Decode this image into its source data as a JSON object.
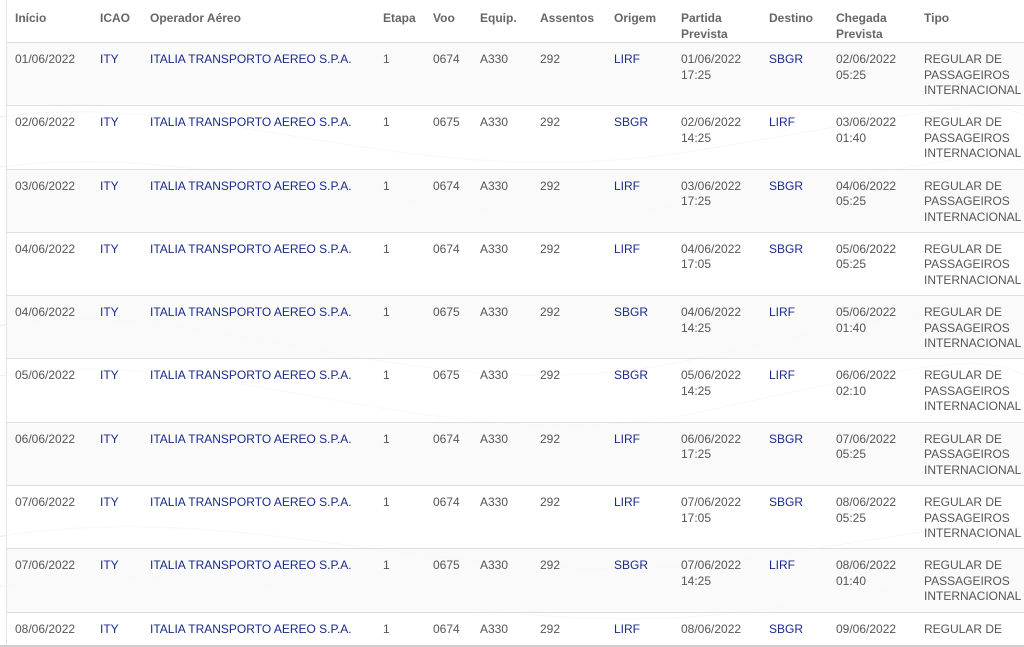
{
  "table": {
    "headers": {
      "inicio": "Início",
      "icao": "ICAO",
      "operador": "Operador Aéreo",
      "etapa": "Etapa",
      "voo": "Voo",
      "equip": "Equip.",
      "assentos": "Assentos",
      "origem": "Origem",
      "partida": "Partida Prevista",
      "destino": "Destino",
      "chegada": "Chegada Prevista",
      "tipo": "Tipo"
    },
    "rows": [
      {
        "inicio": "01/06/2022",
        "icao": "ITY",
        "operador": "ITALIA TRANSPORTO AEREO S.P.A.",
        "etapa": "1",
        "voo": "0674",
        "equip": "A330",
        "assentos": "292",
        "origem": "LIRF",
        "partida": "01/06/2022 17:25",
        "destino": "SBGR",
        "chegada": "02/06/2022 05:25",
        "tipo": "REGULAR DE PASSAGEIROS INTERNACIONAL"
      },
      {
        "inicio": "02/06/2022",
        "icao": "ITY",
        "operador": "ITALIA TRANSPORTO AEREO S.P.A.",
        "etapa": "1",
        "voo": "0675",
        "equip": "A330",
        "assentos": "292",
        "origem": "SBGR",
        "partida": "02/06/2022 14:25",
        "destino": "LIRF",
        "chegada": "03/06/2022 01:40",
        "tipo": "REGULAR DE PASSAGEIROS INTERNACIONAL"
      },
      {
        "inicio": "03/06/2022",
        "icao": "ITY",
        "operador": "ITALIA TRANSPORTO AEREO S.P.A.",
        "etapa": "1",
        "voo": "0674",
        "equip": "A330",
        "assentos": "292",
        "origem": "LIRF",
        "partida": "03/06/2022 17:25",
        "destino": "SBGR",
        "chegada": "04/06/2022 05:25",
        "tipo": "REGULAR DE PASSAGEIROS INTERNACIONAL"
      },
      {
        "inicio": "04/06/2022",
        "icao": "ITY",
        "operador": "ITALIA TRANSPORTO AEREO S.P.A.",
        "etapa": "1",
        "voo": "0674",
        "equip": "A330",
        "assentos": "292",
        "origem": "LIRF",
        "partida": "04/06/2022 17:05",
        "destino": "SBGR",
        "chegada": "05/06/2022 05:25",
        "tipo": "REGULAR DE PASSAGEIROS INTERNACIONAL"
      },
      {
        "inicio": "04/06/2022",
        "icao": "ITY",
        "operador": "ITALIA TRANSPORTO AEREO S.P.A.",
        "etapa": "1",
        "voo": "0675",
        "equip": "A330",
        "assentos": "292",
        "origem": "SBGR",
        "partida": "04/06/2022 14:25",
        "destino": "LIRF",
        "chegada": "05/06/2022 01:40",
        "tipo": "REGULAR DE PASSAGEIROS INTERNACIONAL"
      },
      {
        "inicio": "05/06/2022",
        "icao": "ITY",
        "operador": "ITALIA TRANSPORTO AEREO S.P.A.",
        "etapa": "1",
        "voo": "0675",
        "equip": "A330",
        "assentos": "292",
        "origem": "SBGR",
        "partida": "05/06/2022 14:25",
        "destino": "LIRF",
        "chegada": "06/06/2022 02:10",
        "tipo": "REGULAR DE PASSAGEIROS INTERNACIONAL"
      },
      {
        "inicio": "06/06/2022",
        "icao": "ITY",
        "operador": "ITALIA TRANSPORTO AEREO S.P.A.",
        "etapa": "1",
        "voo": "0674",
        "equip": "A330",
        "assentos": "292",
        "origem": "LIRF",
        "partida": "06/06/2022 17:25",
        "destino": "SBGR",
        "chegada": "07/06/2022 05:25",
        "tipo": "REGULAR DE PASSAGEIROS INTERNACIONAL"
      },
      {
        "inicio": "07/06/2022",
        "icao": "ITY",
        "operador": "ITALIA TRANSPORTO AEREO S.P.A.",
        "etapa": "1",
        "voo": "0674",
        "equip": "A330",
        "assentos": "292",
        "origem": "LIRF",
        "partida": "07/06/2022 17:05",
        "destino": "SBGR",
        "chegada": "08/06/2022 05:25",
        "tipo": "REGULAR DE PASSAGEIROS INTERNACIONAL"
      },
      {
        "inicio": "07/06/2022",
        "icao": "ITY",
        "operador": "ITALIA TRANSPORTO AEREO S.P.A.",
        "etapa": "1",
        "voo": "0675",
        "equip": "A330",
        "assentos": "292",
        "origem": "SBGR",
        "partida": "07/06/2022 14:25",
        "destino": "LIRF",
        "chegada": "08/06/2022 01:40",
        "tipo": "REGULAR DE PASSAGEIROS INTERNACIONAL"
      },
      {
        "inicio": "08/06/2022",
        "icao": "ITY",
        "operador": "ITALIA TRANSPORTO AEREO S.P.A.",
        "etapa": "1",
        "voo": "0674",
        "equip": "A330",
        "assentos": "292",
        "origem": "LIRF",
        "partida": "08/06/2022",
        "destino": "SBGR",
        "chegada": "09/06/2022",
        "tipo": "REGULAR DE"
      }
    ]
  },
  "colors": {
    "link": "#1a2a8a",
    "text": "#555555",
    "header_text": "#666666",
    "row_alt": "#f9f9f9",
    "border": "#dddddd"
  }
}
